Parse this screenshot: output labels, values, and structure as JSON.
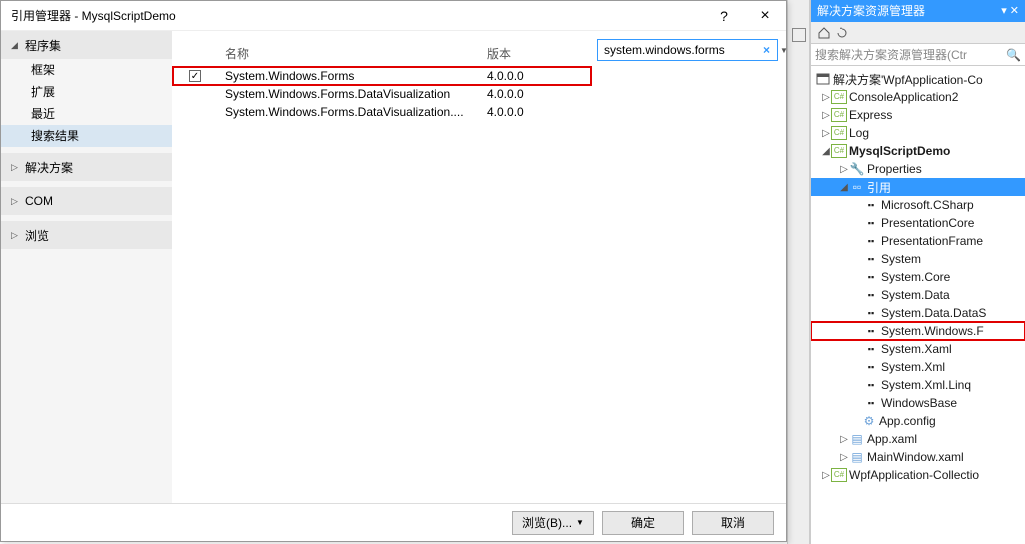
{
  "dialog": {
    "title": "引用管理器 - MysqlScriptDemo",
    "help": "?",
    "close": "×",
    "left": {
      "expanded_arrow": "◢",
      "collapsed_arrow": "▷",
      "assemblies": "程序集",
      "framework": "框架",
      "extensions": "扩展",
      "recent": "最近",
      "search_results": "搜索结果",
      "solution": "解决方案",
      "com": "COM",
      "browse": "浏览"
    },
    "columns": {
      "name": "名称",
      "version": "版本"
    },
    "rows": [
      {
        "checked": true,
        "name": "System.Windows.Forms",
        "version": "4.0.0.0",
        "highlight": true
      },
      {
        "checked": false,
        "name": "System.Windows.Forms.DataVisualization",
        "version": "4.0.0.0",
        "highlight": false
      },
      {
        "checked": false,
        "name": "System.Windows.Forms.DataVisualization....",
        "version": "4.0.0.0",
        "highlight": false
      }
    ],
    "search": {
      "value": "system.windows.forms",
      "clear": "×"
    },
    "footer": {
      "browse": "浏览(B)...",
      "ok": "确定",
      "cancel": "取消"
    }
  },
  "ide": {
    "panel_title": "解决方案资源管理器",
    "panel_buttons": "▾ ✕",
    "search_placeholder": "搜索解决方案资源管理器(Ctr",
    "solution_label": "解决方案'WpfApplication-Co",
    "tree": {
      "console": "ConsoleApplication2",
      "express": "Express",
      "log": "Log",
      "demo": "MysqlScriptDemo",
      "properties": "Properties",
      "references": "引用",
      "refs": [
        "Microsoft.CSharp",
        "PresentationCore",
        "PresentationFrame",
        "System",
        "System.Core",
        "System.Data",
        "System.Data.DataS",
        "System.Windows.F",
        "System.Xaml",
        "System.Xml",
        "System.Xml.Linq",
        "WindowsBase"
      ],
      "appconfig": "App.config",
      "appxaml": "App.xaml",
      "mainwindow": "MainWindow.xaml",
      "wpfapp": "WpfApplication-Collectio"
    }
  },
  "icons": {
    "home": "⌂",
    "refresh": "↻",
    "search": "🔍",
    "check": "✓",
    "expander_open": "◢",
    "expander_closed": "▷"
  }
}
